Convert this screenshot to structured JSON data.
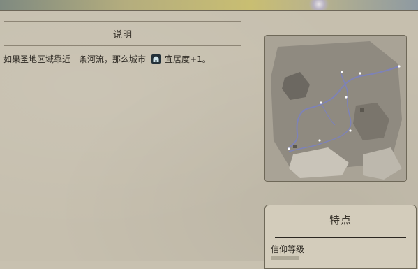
{
  "description_section": {
    "title": "说明",
    "text_before_icon": "如果圣地区域靠近一条河流，那么城市",
    "icon": "amenity-icon",
    "text_after_icon": "宜居度+1。"
  },
  "preview_map": {
    "alt": "map-preview"
  },
  "traits_card": {
    "title": "特点",
    "rows": [
      "信仰等级"
    ]
  }
}
